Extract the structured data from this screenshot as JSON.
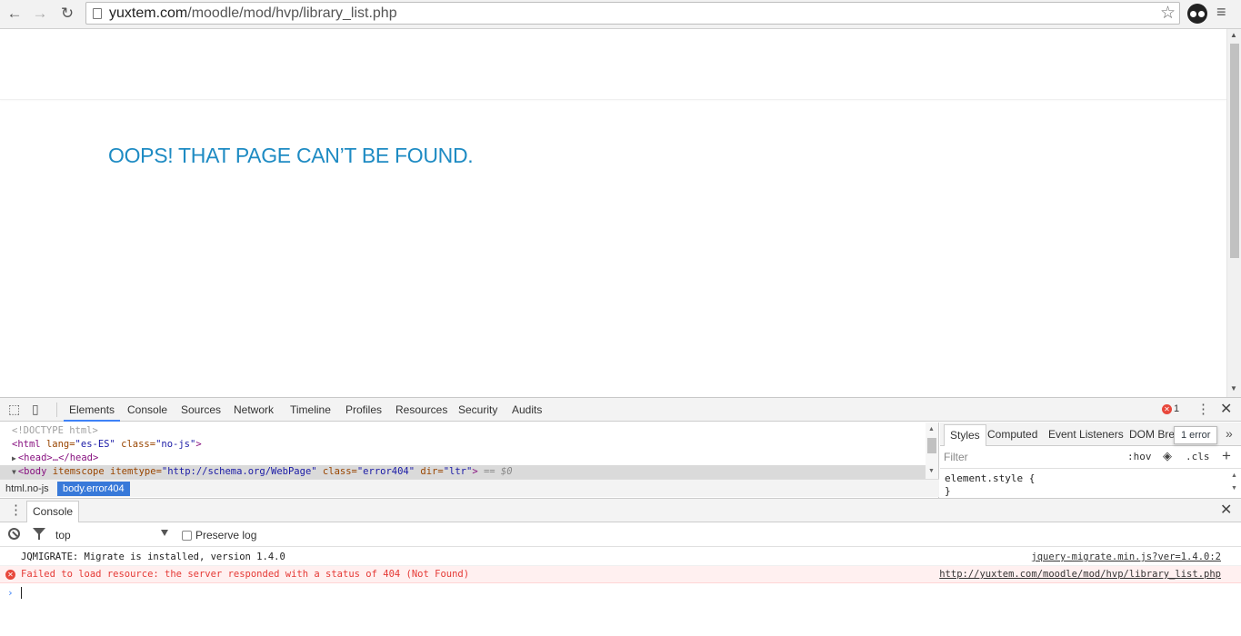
{
  "browser": {
    "back_icon": "←",
    "forward_icon": "→",
    "reload_icon": "↻",
    "url_host": "yuxtem.com",
    "url_path": "/moodle/mod/hvp/library_list.php",
    "star_icon": "☆",
    "menu_icon": "≡"
  },
  "page": {
    "title": "OOPS! THAT PAGE CAN’T BE FOUND.",
    "title_color": "#1e8bc3"
  },
  "devtools": {
    "tabs": [
      "Elements",
      "Console",
      "Sources",
      "Network",
      "Timeline",
      "Profiles",
      "Resources",
      "Security",
      "Audits"
    ],
    "active_tab": "Elements",
    "error_count": "1",
    "dom": {
      "doctype": "<!DOCTYPE html>",
      "html_open_tag": "<html",
      "html_lang_attr": "lang=",
      "html_lang_val": "\"es-ES\"",
      "html_class_attr": "class=",
      "html_class_val": "\"no-js\"",
      "html_close": ">",
      "head": "<head>…</head>",
      "body_tag": "<body",
      "body_itemscope": "itemscope",
      "body_itemtype_attr": "itemtype=",
      "body_itemtype_val": "\"http://schema.org/WebPage\"",
      "body_class_attr": "class=",
      "body_class_val": "\"error404\"",
      "body_dir_attr": "dir=",
      "body_dir_val": "\"ltr\"",
      "body_close": ">",
      "body_ref": "== $0"
    },
    "breadcrumbs": [
      "html.no-js",
      "body.error404"
    ],
    "styles": {
      "tabs": [
        "Styles",
        "Computed",
        "Event Listeners",
        "DOM Bre"
      ],
      "tooltip": "1 error",
      "filter_placeholder": "Filter",
      "hov_label": ":hov",
      "cls_label": ".cls",
      "rule": "element.style {\n}"
    },
    "drawer": {
      "tab_label": "Console",
      "context": "top",
      "preserve_log_label": "Preserve log",
      "logs": [
        {
          "level": "info",
          "message": "JQMIGRATE: Migrate is installed, version 1.4.0",
          "source": "jquery-migrate.min.js?ver=1.4.0:2"
        },
        {
          "level": "error",
          "message": "Failed to load resource: the server responded with a status of 404 (Not Found)",
          "source": "http://yuxtem.com/moodle/mod/hvp/library_list.php"
        }
      ],
      "prompt": "›"
    },
    "accent_color": "#3e82f7",
    "error_color": "#e53935"
  }
}
